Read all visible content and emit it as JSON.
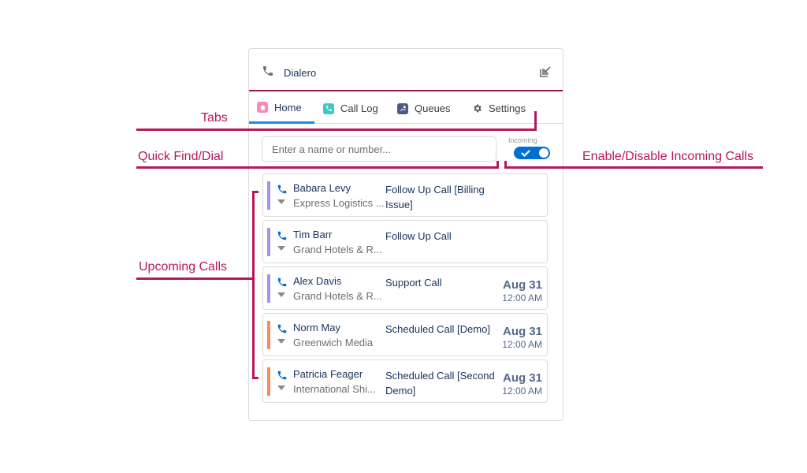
{
  "header": {
    "title": "Dialero",
    "popout_icon": "popout-icon"
  },
  "tabs": [
    {
      "label": "Home",
      "icon": "home-icon",
      "icon_color": "#f38cb6",
      "active": true
    },
    {
      "label": "Call Log",
      "icon": "call-log-icon",
      "icon_color": "#41c8c4",
      "active": false
    },
    {
      "label": "Queues",
      "icon": "queues-icon",
      "icon_color": "#4b5a8a",
      "active": false
    },
    {
      "label": "Settings",
      "icon": "gear-icon",
      "icon_color": "#555555",
      "active": false
    }
  ],
  "search": {
    "placeholder": "Enter a name or number...",
    "value": ""
  },
  "incoming": {
    "label": "Incoming",
    "enabled": true
  },
  "calls": [
    {
      "name": "Babara Levy",
      "company": "Express Logistics ...",
      "subject": "Follow Up Call [Billing Issue]",
      "date": "",
      "time": "",
      "accent": "#a094ed"
    },
    {
      "name": "Tim Barr",
      "company": "Grand Hotels & R...",
      "subject": "Follow Up Call",
      "date": "",
      "time": "",
      "accent": "#a094ed"
    },
    {
      "name": "Alex Davis",
      "company": "Grand Hotels & R...",
      "subject": "Support Call",
      "date": "Aug 31",
      "time": "12:00 AM",
      "accent": "#a094ed"
    },
    {
      "name": "Norm May",
      "company": "Greenwich Media",
      "subject": "Scheduled Call [Demo]",
      "date": "Aug 31",
      "time": "12:00 AM",
      "accent": "#f88962"
    },
    {
      "name": "Patricia Feager",
      "company": "International Shi...",
      "subject": "Scheduled Call [Second Demo]",
      "date": "Aug 31",
      "time": "12:00 AM",
      "accent": "#f88962"
    }
  ],
  "annotations": {
    "tabs": "Tabs",
    "quick_find": "Quick Find/Dial",
    "incoming": "Enable/Disable Incoming Calls",
    "upcoming": "Upcoming Calls",
    "color": "#b5195a"
  },
  "colors": {
    "header_rule": "#9b1a4b",
    "active_tab": "#1589ee",
    "toggle": "#0070d2",
    "phone_blue": "#0070d2"
  }
}
